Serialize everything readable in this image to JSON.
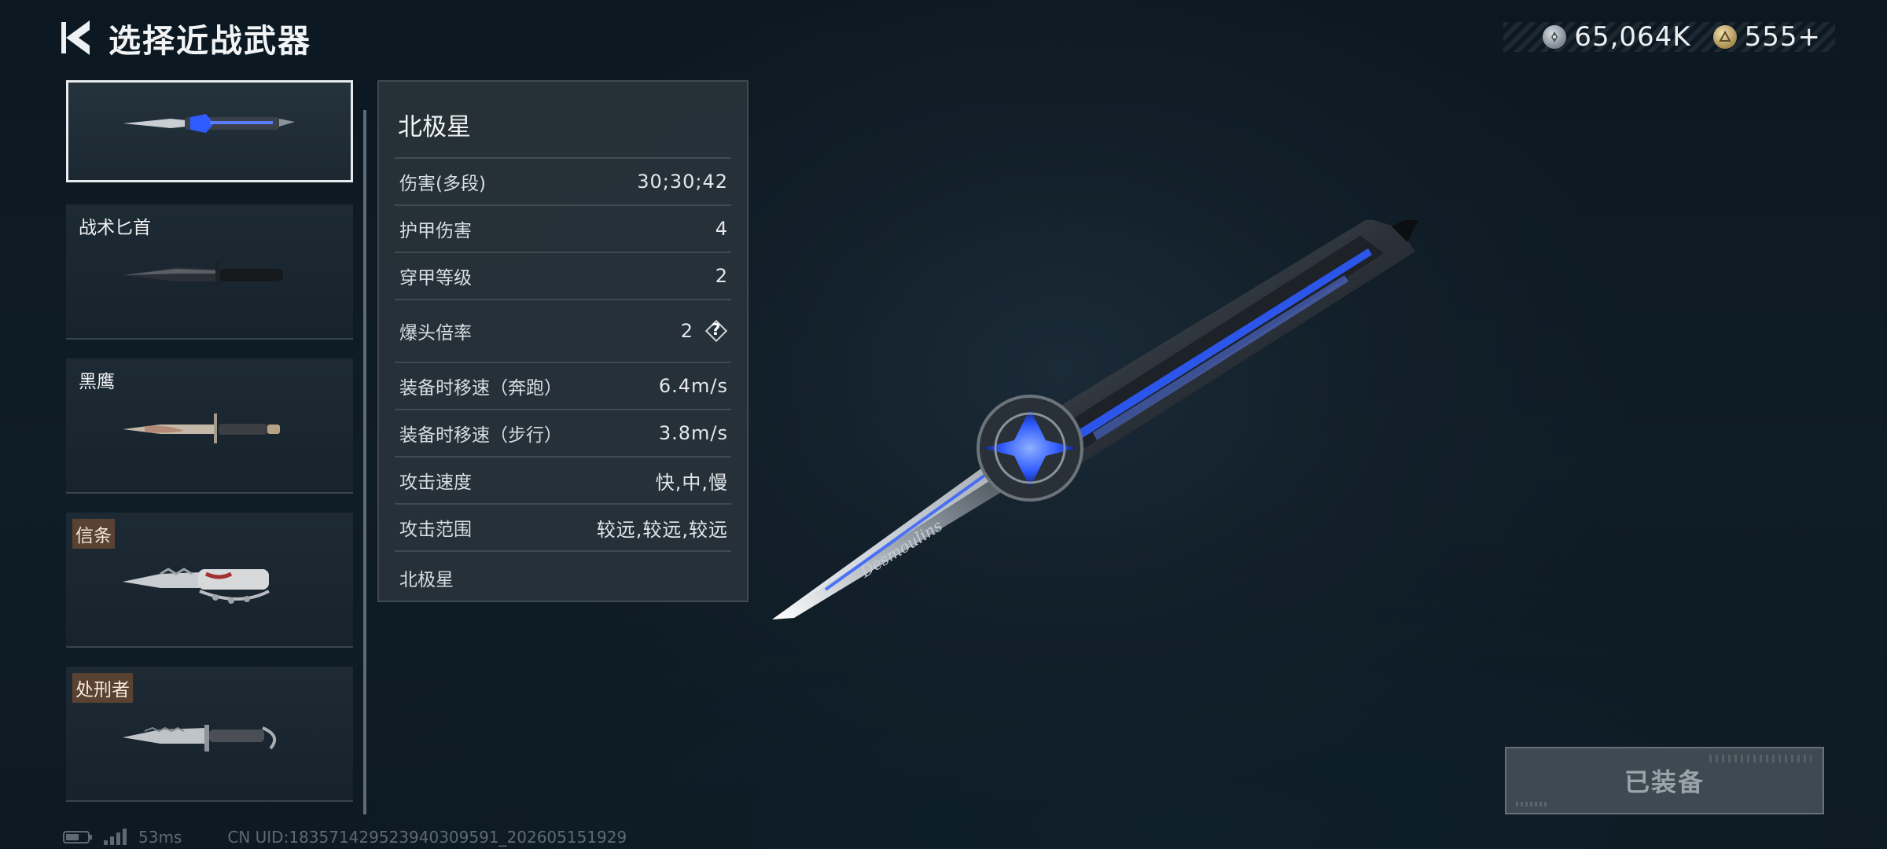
{
  "header": {
    "title": "选择近战武器"
  },
  "currency": {
    "silver_value": "65,064K",
    "gold_value": "555+"
  },
  "weapon_list": [
    {
      "label": "",
      "selected": true
    },
    {
      "label": "战术匕首",
      "tagged": false
    },
    {
      "label": "黑鹰",
      "tagged": false
    },
    {
      "label": "信条",
      "tagged": true
    },
    {
      "label": "处刑者",
      "tagged": true
    }
  ],
  "stats": {
    "title": "北极星",
    "rows": [
      {
        "label": "伤害(多段)",
        "value": "30;30;42"
      },
      {
        "label": "护甲伤害",
        "value": "4"
      },
      {
        "label": "穿甲等级",
        "value": "2"
      },
      {
        "label": "爆头倍率",
        "value": "2",
        "help": "?"
      },
      {
        "label": "装备时移速（奔跑）",
        "value": "6.4m/s"
      },
      {
        "label": "装备时移速（步行）",
        "value": "3.8m/s"
      },
      {
        "label": "攻击速度",
        "value": "快,中,慢"
      },
      {
        "label": "攻击范围",
        "value": "较远,较远,较远"
      }
    ],
    "footer": "北极星"
  },
  "showcase": {
    "blade_engraving": "Desmoulins"
  },
  "equip_button": {
    "label": "已装备"
  },
  "status_bar": {
    "ping": "53ms",
    "uid": "CN UID:18357142952394030959​1_202605151929"
  },
  "colors": {
    "background": "#0d1a23",
    "panel": "#283239",
    "accent_blue": "#2f5bff",
    "tag_brown": "#5a4232"
  }
}
